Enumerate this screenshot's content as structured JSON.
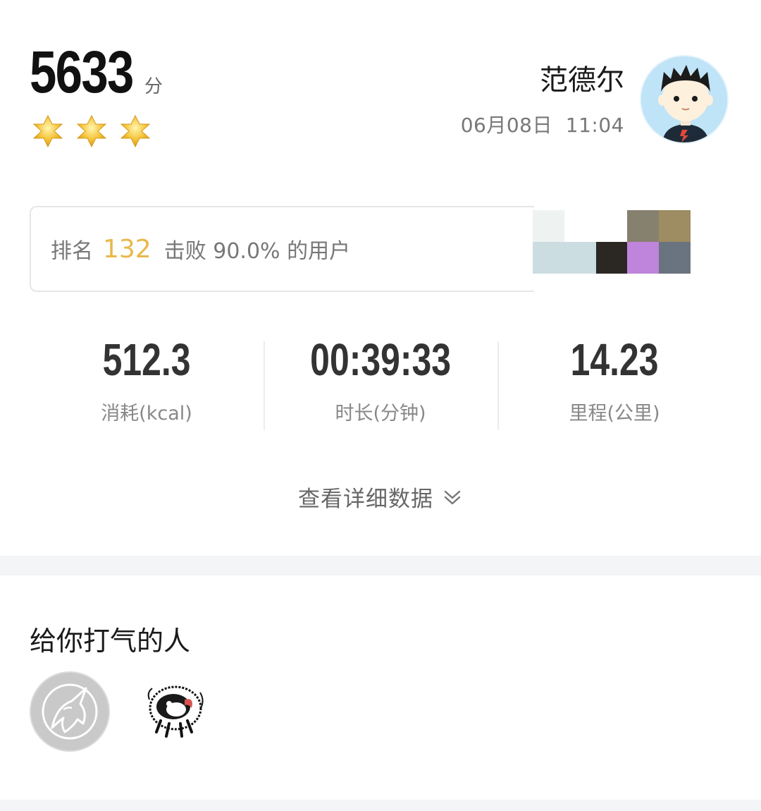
{
  "score": {
    "value": "5633",
    "unit": "分",
    "stars": 3
  },
  "user": {
    "name": "范德尔",
    "date": "06月08日",
    "time": "11:04"
  },
  "rank": {
    "label": "排名",
    "position": "132",
    "beat_text": "击败 90.0% 的用户"
  },
  "stats": [
    {
      "value": "512.3",
      "label": "消耗(kcal)"
    },
    {
      "value": "00:39:33",
      "label": "时长(分钟)"
    },
    {
      "value": "14.23",
      "label": "里程(公里)"
    }
  ],
  "detail_link": {
    "label": "查看详细数据"
  },
  "cheer": {
    "title": "给你打气的人"
  },
  "colors": {
    "accent_rank": "#e8b84a",
    "star_fill": "#f6c43a",
    "divider": "#f3f5f7"
  },
  "icons": {
    "star": "star-icon",
    "chevron": "double-chevron-down-icon",
    "unicorn": "unicorn-icon"
  }
}
